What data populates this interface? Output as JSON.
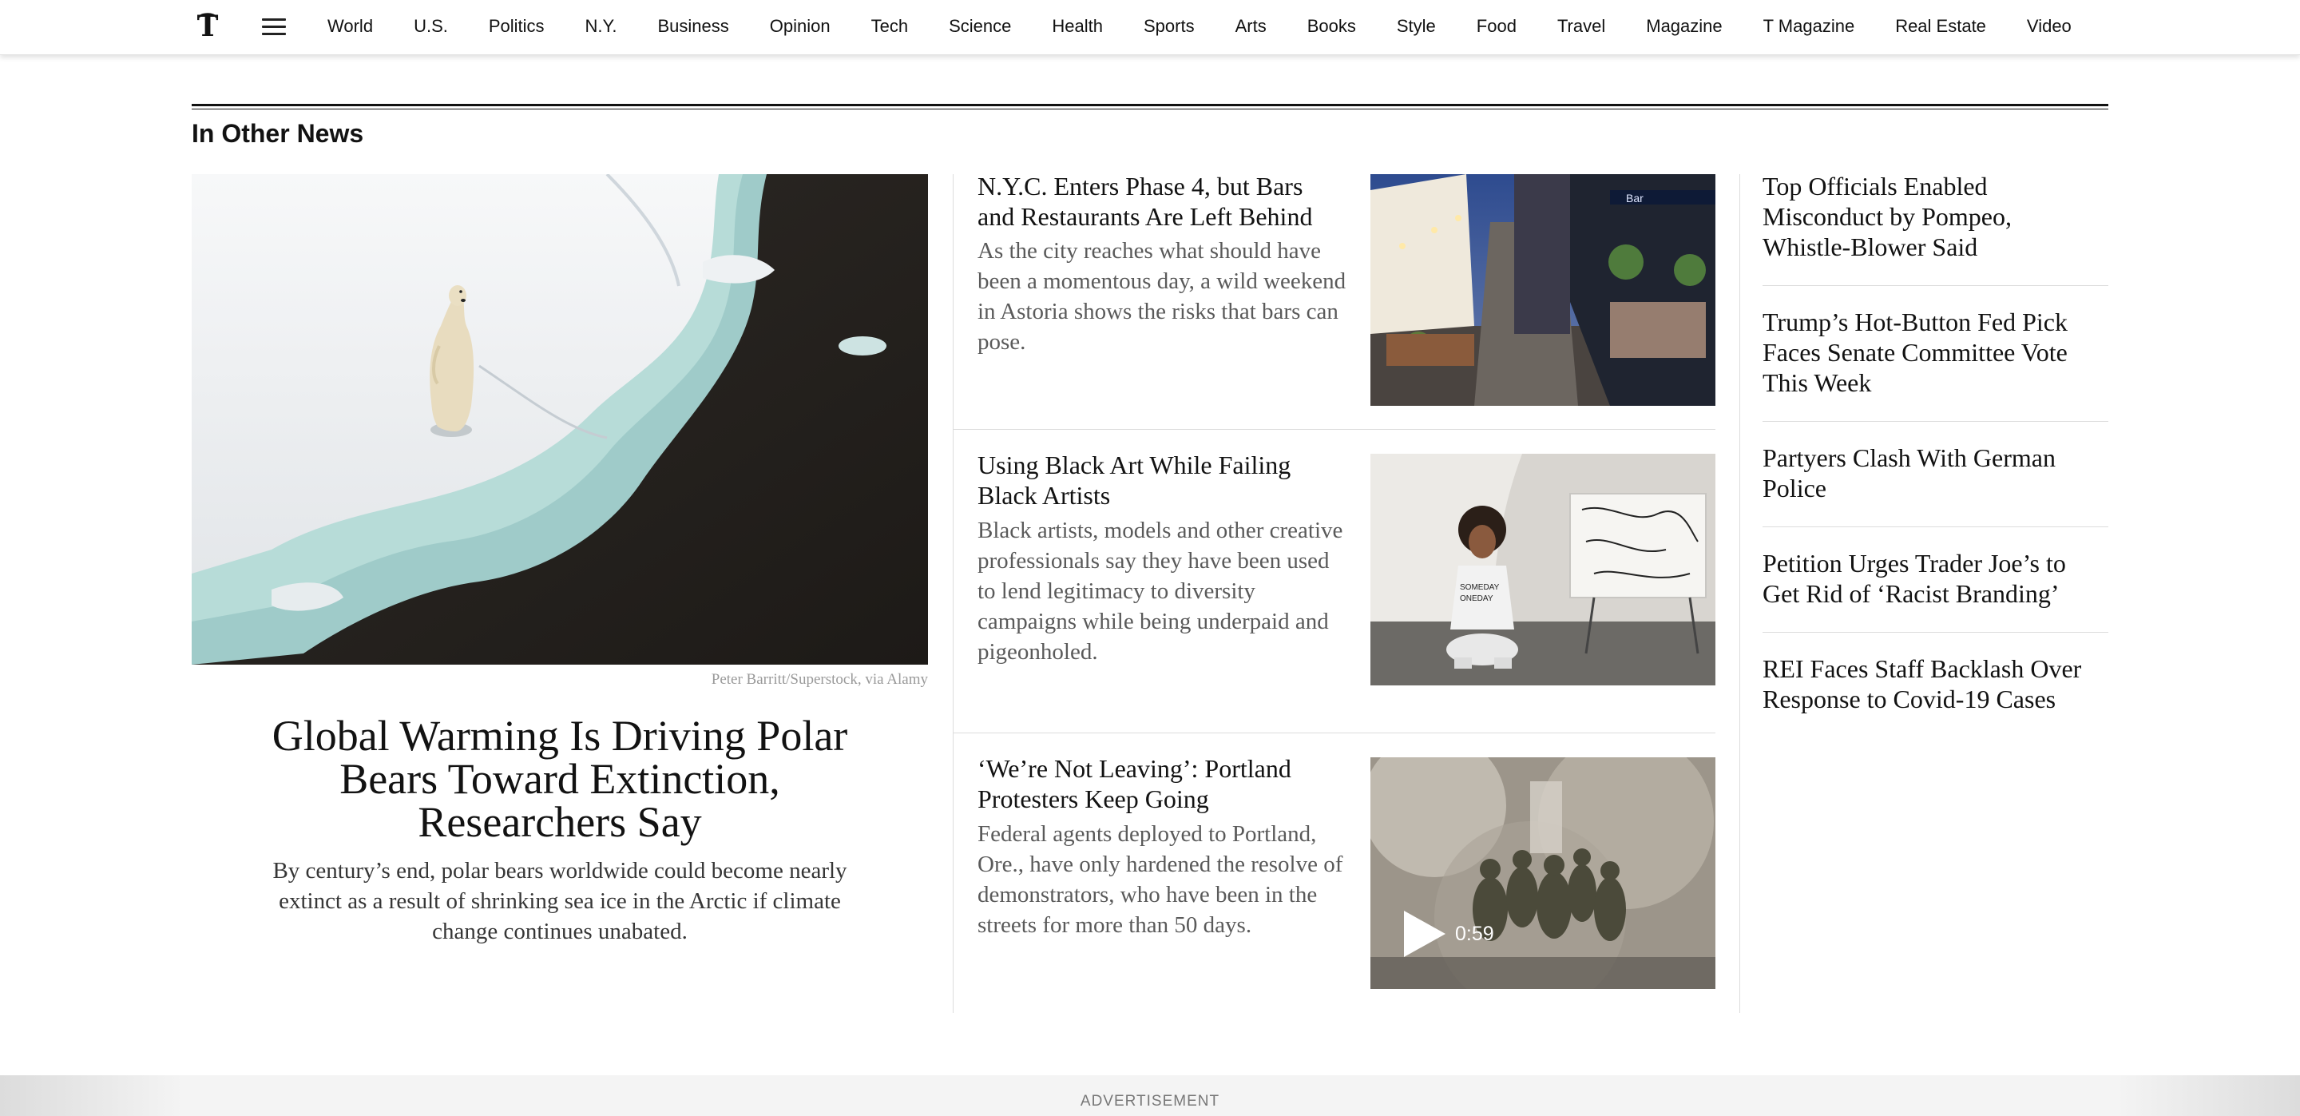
{
  "nav": {
    "items": [
      "World",
      "U.S.",
      "Politics",
      "N.Y.",
      "Business",
      "Opinion",
      "Tech",
      "Science",
      "Health",
      "Sports",
      "Arts",
      "Books",
      "Style",
      "Food",
      "Travel",
      "Magazine",
      "T Magazine",
      "Real Estate",
      "Video"
    ]
  },
  "section": {
    "title": "In Other News"
  },
  "lead": {
    "credit": "Peter Barritt/Superstock, via Alamy",
    "headline": "Global Warming Is Driving Polar Bears Toward Extinction, Researchers Say",
    "summary": "By century’s end, polar bears worldwide could become nearly extinct as a result of shrinking sea ice in the Arctic if climate change continues unabated."
  },
  "stories": [
    {
      "headline": "N.Y.C. Enters Phase 4, but Bars and Restaurants Are Left Behind",
      "summary": "As the city reaches what should have been a momentous day, a wild weekend in Astoria shows the risks that bars can pose."
    },
    {
      "headline": "Using Black Art While Failing Black Artists",
      "summary": "Black artists, models and other creative professionals say they have been used to lend legitimacy to diversity campaigns while being underpaid and pigeonholed."
    },
    {
      "headline": "‘We’re Not Leaving’: Portland Protesters Keep Going",
      "summary": "Federal agents deployed to Portland, Ore., have only hardened the resolve of demonstrators, who have been in the streets for more than 50 days.",
      "video_duration": "0:59"
    }
  ],
  "right_column": {
    "headlines": [
      "Top Officials Enabled Misconduct by Pompeo, Whistle-Blower Said",
      "Trump’s Hot-Button Fed Pick Faces Senate Committee Vote This Week",
      "Partyers Clash With German Police",
      "Petition Urges Trader Joe’s to Get Rid of ‘Racist Branding’",
      "REI Faces Staff Backlash Over Response to Covid-19 Cases"
    ]
  },
  "ad": {
    "label": "ADVERTISEMENT"
  },
  "icons": {
    "logo": "nyt-t-logo-icon",
    "menu": "hamburger-menu-icon",
    "play": "play-icon"
  },
  "colors": {
    "text": "#121212",
    "summary": "#5a5a5a",
    "divider": "#dcdcdc"
  }
}
